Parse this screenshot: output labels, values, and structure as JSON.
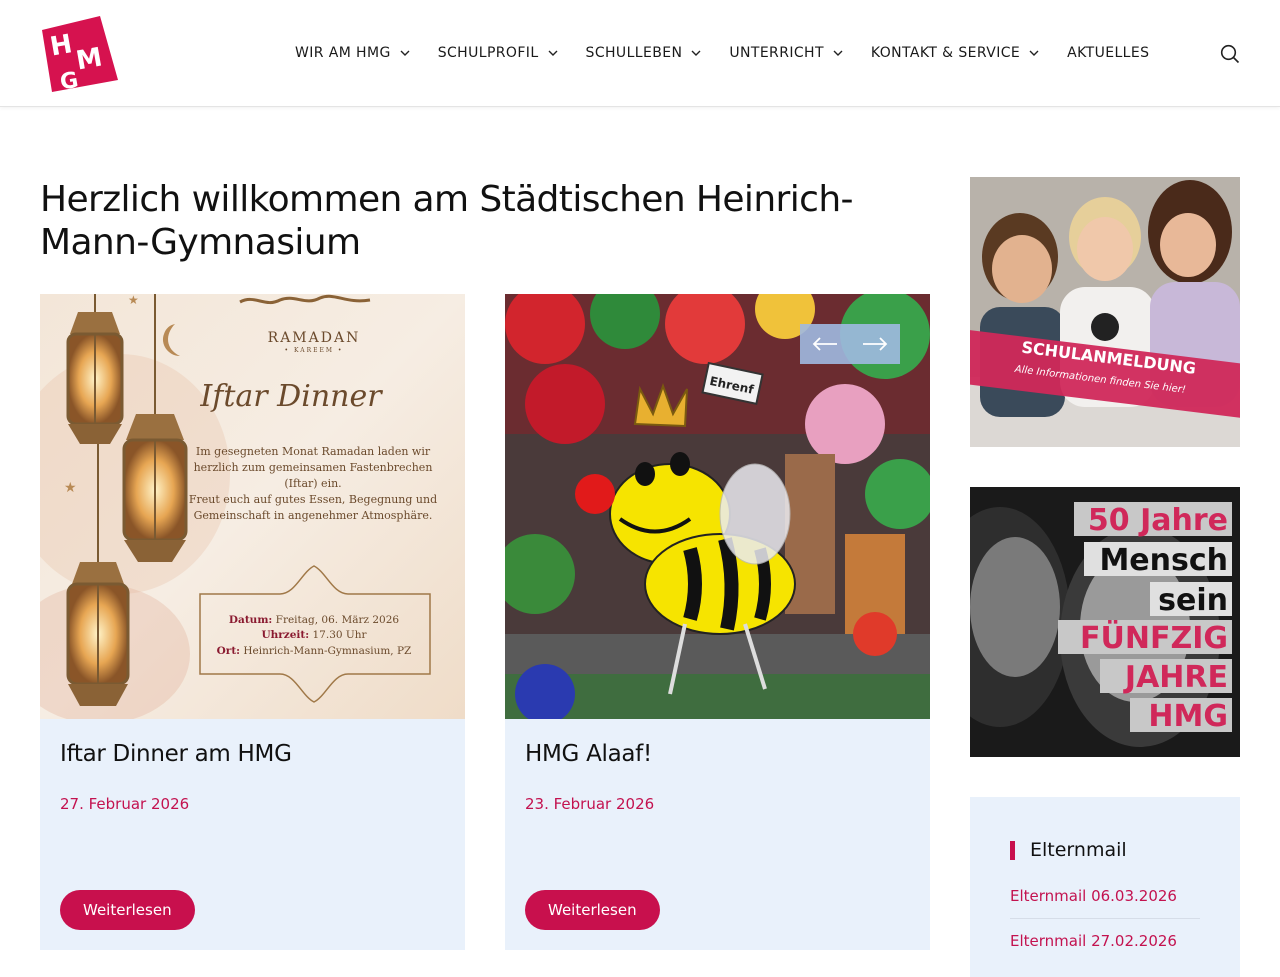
{
  "header": {
    "logo_letters": "HMG",
    "nav": [
      {
        "label": "WIR AM HMG",
        "has_dropdown": true
      },
      {
        "label": "SCHULPROFIL",
        "has_dropdown": true
      },
      {
        "label": "SCHULLEBEN",
        "has_dropdown": true
      },
      {
        "label": "UNTERRICHT",
        "has_dropdown": true
      },
      {
        "label": "KONTAKT & SERVICE",
        "has_dropdown": true
      },
      {
        "label": "AKTUELLES",
        "has_dropdown": false
      }
    ],
    "search_icon": "search-icon"
  },
  "main": {
    "title": "Herzlich willkommen am Städtischen Heinrich-Mann-Gymnasium",
    "posts": [
      {
        "title": "Iftar Dinner am HMG",
        "date": "27. Februar 2026",
        "button": "Weiterlesen",
        "image": {
          "ramadan": "RAMADAN",
          "kareem": "• KAREEM •",
          "heading": "Iftar Dinner",
          "body_lines": [
            "Im gesegneten Monat Ramadan laden wir",
            "herzlich zum gemeinsamen Fastenbrechen",
            "(Iftar) ein.",
            "Freut euch auf gutes Essen, Begegnung und",
            "Gemeinschaft in angenehmer Atmosphäre."
          ],
          "details": [
            {
              "label": "Datum:",
              "value": "Freitag, 06. März 2026"
            },
            {
              "label": "Uhrzeit:",
              "value": "17.30 Uhr"
            },
            {
              "label": "Ort:",
              "value": "Heinrich-Mann-Gymnasium, PZ"
            }
          ]
        }
      },
      {
        "title": "HMG Alaaf!",
        "date": "23. Februar 2026",
        "button": "Weiterlesen",
        "image": {
          "sign": "Ehrenf"
        }
      }
    ],
    "slider": {
      "prev_icon": "arrow-left-icon",
      "next_icon": "arrow-right-icon"
    }
  },
  "sidebar": {
    "banner1": {
      "title": "SCHULANMELDUNG",
      "subtitle": "Alle Informationen finden Sie hier!"
    },
    "banner2": {
      "lines": [
        "50 Jahre",
        "Mensch",
        "sein",
        "FÜNFZIG",
        "JAHRE",
        "HMG"
      ]
    },
    "elternmail": {
      "heading": "Elternmail",
      "links": [
        "Elternmail 06.03.2026",
        "Elternmail 27.02.2026"
      ]
    }
  },
  "colors": {
    "accent": "#c8104d",
    "card_bg": "#e9f1fb",
    "text": "#111111"
  }
}
